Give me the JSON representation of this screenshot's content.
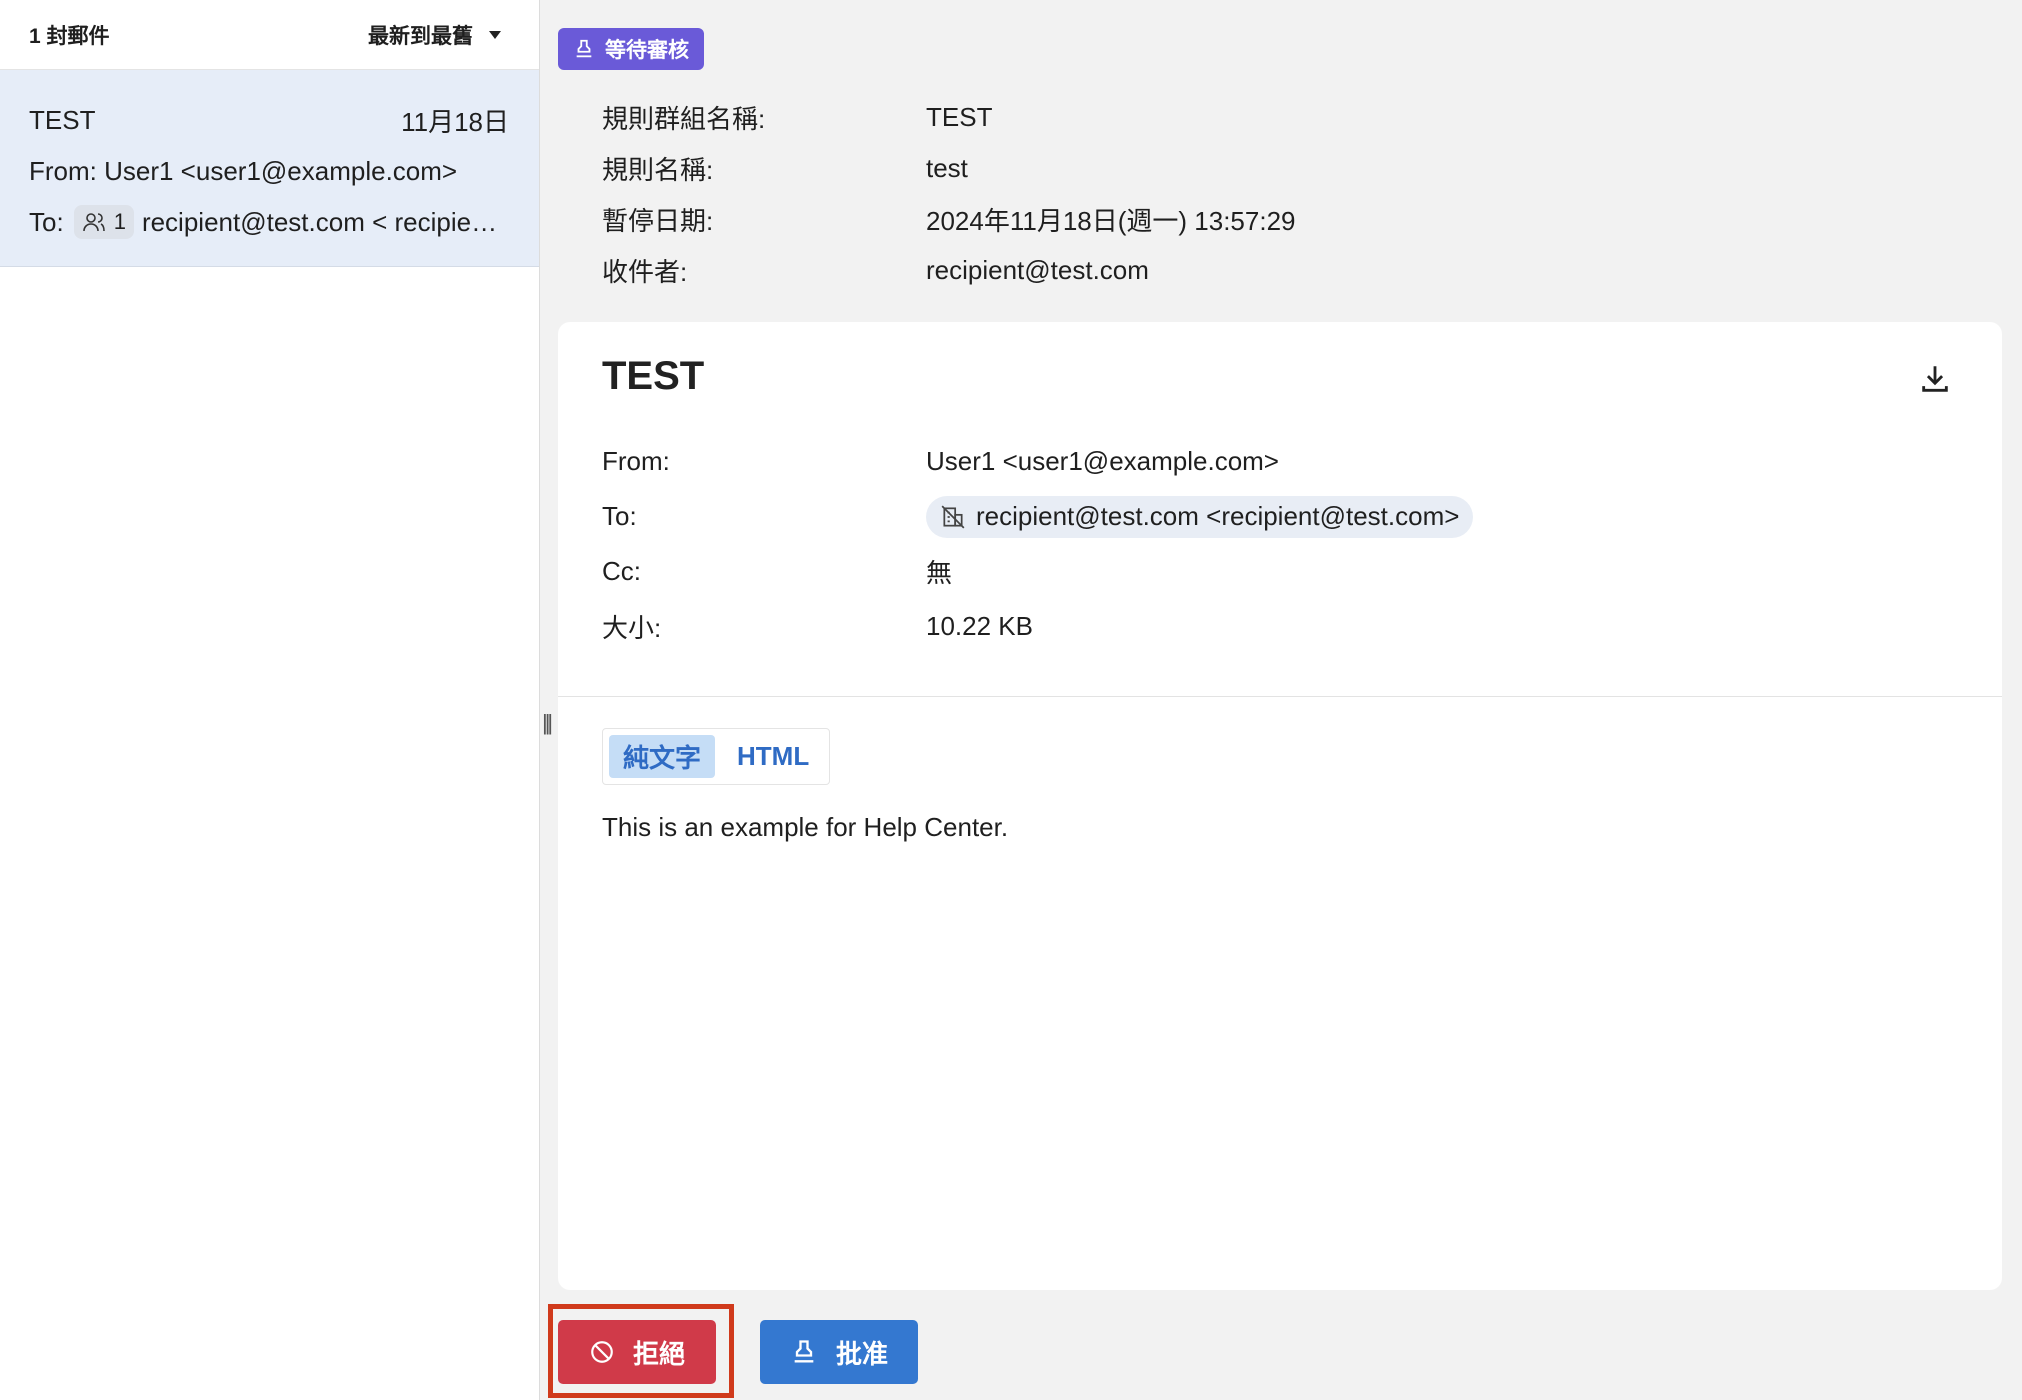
{
  "list": {
    "count_label": "1 封郵件",
    "sort_label": "最新到最舊",
    "items": [
      {
        "subject": "TEST",
        "date": "11月18日",
        "from": "From: User1 <user1@example.com>",
        "to_label": "To:",
        "recipient_count": "1",
        "to_value": "recipient@test.com < recipient@test.com >"
      }
    ]
  },
  "status_badge": "等待審核",
  "rule_meta": {
    "group_label": "規則群組名稱:",
    "group_value": "TEST",
    "rule_label": "規則名稱:",
    "rule_value": "test",
    "date_label": "暫停日期:",
    "date_value": "2024年11月18日(週一) 13:57:29",
    "recipient_label": "收件者:",
    "recipient_value": "recipient@test.com"
  },
  "message": {
    "subject": "TEST",
    "from_label": "From:",
    "from_value": "User1 <user1@example.com>",
    "to_label": "To:",
    "to_value": "recipient@test.com <recipient@test.com>",
    "cc_label": "Cc:",
    "cc_value": "無",
    "size_label": "大小:",
    "size_value": "10.22 KB",
    "tabs": [
      "純文字",
      "HTML"
    ],
    "active_tab": "純文字",
    "body": "This is an example for Help Center."
  },
  "actions": {
    "reject": "拒絕",
    "approve": "批准"
  }
}
